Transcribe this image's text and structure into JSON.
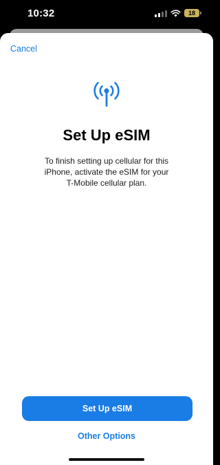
{
  "status_bar": {
    "time": "10:32",
    "battery_level": "18",
    "battery_color": "#c9b25a",
    "icons": [
      "signal-icon",
      "wifi-icon",
      "battery-icon"
    ]
  },
  "sheet": {
    "cancel_label": "Cancel",
    "icon": "antenna-icon",
    "title": "Set Up eSIM",
    "description": "To finish setting up cellular for this iPhone, activate the eSIM for your T-Mobile cellular plan.",
    "primary_button_label": "Set Up eSIM",
    "secondary_link_label": "Other Options"
  },
  "colors": {
    "accent": "#1a7ce5",
    "background": "#ffffff"
  }
}
